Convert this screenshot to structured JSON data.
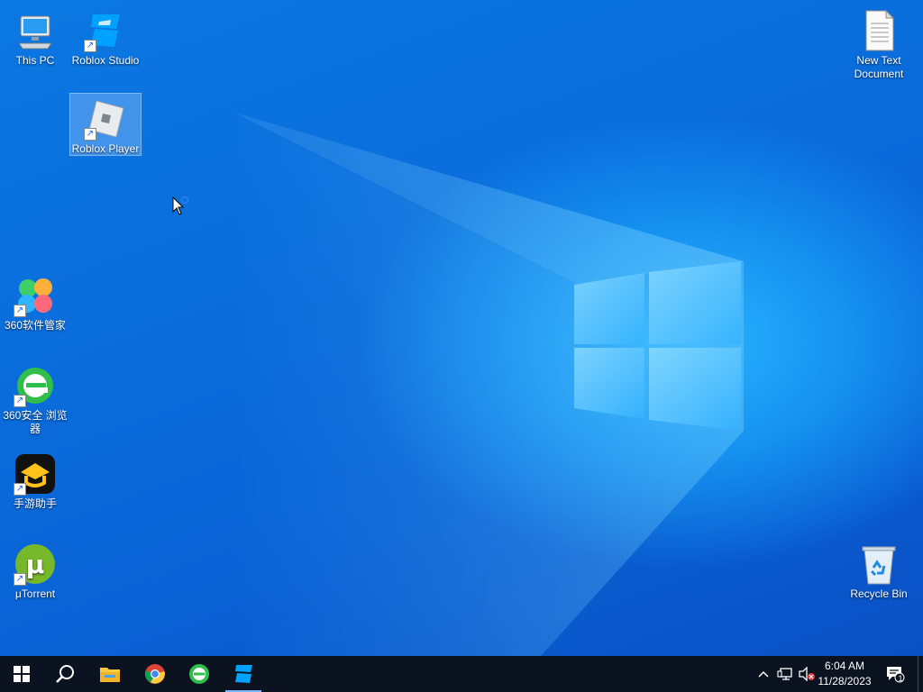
{
  "desktop": {
    "icons": [
      {
        "label": "This PC",
        "icon": "computer-icon"
      },
      {
        "label": "Roblox Studio",
        "icon": "roblox-studio-icon"
      },
      {
        "label": "Roblox Player",
        "icon": "roblox-player-icon"
      },
      {
        "label": "360软件管家",
        "icon": "360-software-manager-icon"
      },
      {
        "label": "360安全 浏览器",
        "icon": "360-browser-icon"
      },
      {
        "label": "手游助手",
        "icon": "mobile-game-assistant-icon"
      },
      {
        "label": "μTorrent",
        "icon": "utorrent-icon"
      },
      {
        "label": "New Text Document",
        "icon": "text-document-icon"
      },
      {
        "label": "Recycle Bin",
        "icon": "recycle-bin-icon"
      }
    ],
    "selected": "Roblox Player"
  },
  "taskbar": {
    "buttons": [
      {
        "name": "start",
        "icon": "windows-logo-icon"
      },
      {
        "name": "search",
        "icon": "search-icon"
      },
      {
        "name": "file-explorer",
        "icon": "folder-icon"
      },
      {
        "name": "chrome",
        "icon": "chrome-icon"
      },
      {
        "name": "360-browser",
        "icon": "360-browser-icon"
      },
      {
        "name": "roblox-studio",
        "icon": "roblox-studio-icon",
        "active": true
      }
    ],
    "tray": {
      "time": "6:04 AM",
      "date": "11/28/2023",
      "notification_count": "1"
    }
  },
  "colors": {
    "taskbar": "#0b1320",
    "accent": "#7ab8ff",
    "wallpaper": "#0a6edc"
  }
}
